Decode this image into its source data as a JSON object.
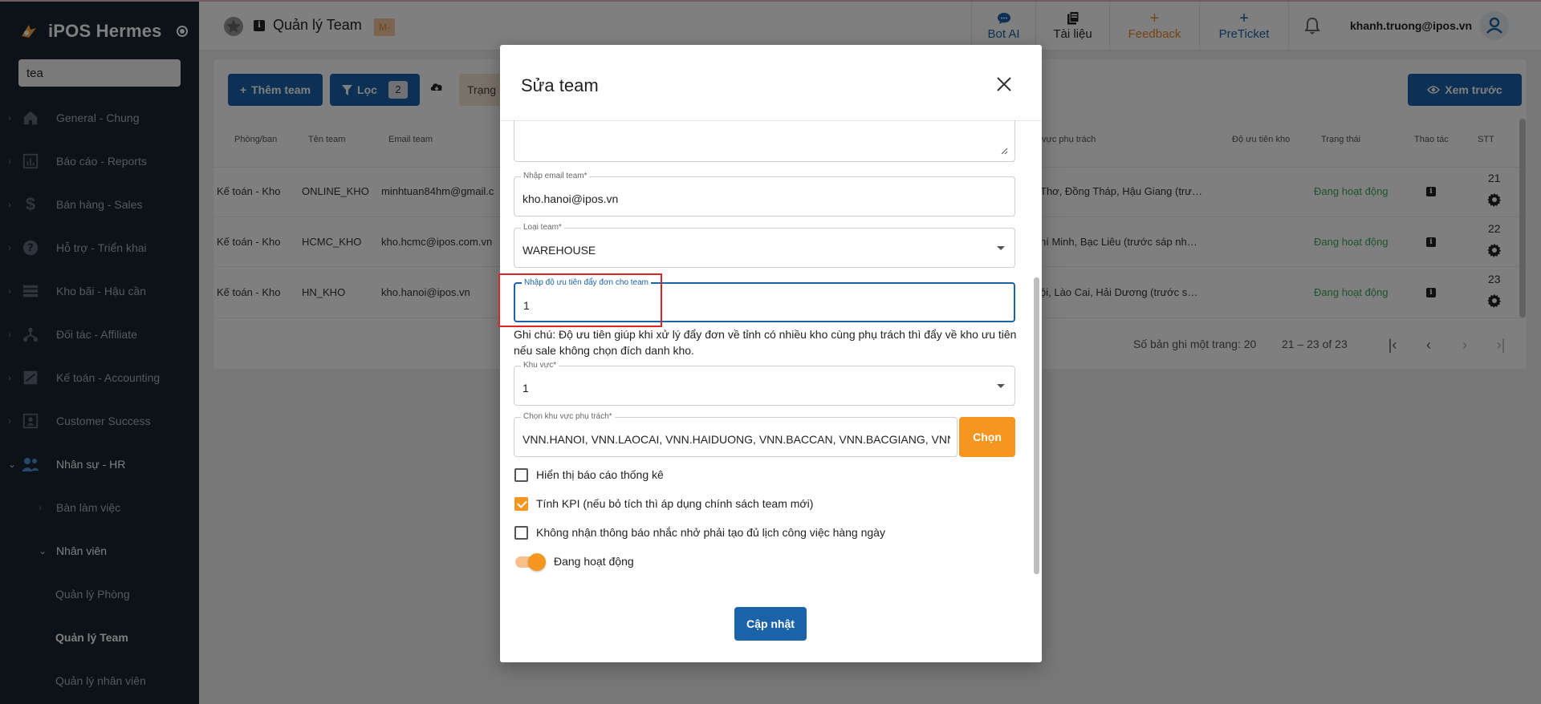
{
  "sidebar": {
    "brand": "iPOS Hermes",
    "search_value": "tea",
    "items": [
      {
        "label": "General - Chung",
        "icon": "home-icon"
      },
      {
        "label": "Báo cáo - Reports",
        "icon": "report-icon"
      },
      {
        "label": "Bán hàng - Sales",
        "icon": "dollar-icon"
      },
      {
        "label": "Hỗ trợ - Triển khai",
        "icon": "help-icon"
      },
      {
        "label": "Kho bãi - Hậu cần",
        "icon": "warehouse-icon"
      },
      {
        "label": "Đối tác - Affiliate",
        "icon": "affiliate-icon"
      },
      {
        "label": "Kế toán - Accounting",
        "icon": "accounting-icon"
      },
      {
        "label": "Customer Success",
        "icon": "customer-icon"
      },
      {
        "label": "Nhân sự - HR",
        "icon": "people-icon"
      }
    ],
    "hr_sub": {
      "workspace": "Bàn làm việc",
      "employee": "Nhân viên"
    },
    "employee_sub": [
      "Quản lý Phòng",
      "Quản lý Team",
      "Quản lý nhân viên"
    ]
  },
  "header": {
    "title": "Quản lý Team",
    "badge": "M-",
    "buttons": [
      {
        "label": "Bot AI",
        "icon": "chat-icon",
        "color": "#1b63a8"
      },
      {
        "label": "Tài liệu",
        "icon": "book-icon",
        "color": "#222222"
      },
      {
        "label": "Feedback",
        "icon": "+",
        "color": "#e8892c"
      },
      {
        "label": "PreTicket",
        "icon": "+",
        "color": "#1b63a8"
      }
    ],
    "user_email": "khanh.truong@ipos.vn"
  },
  "toolbar": {
    "add_label": "Thêm team",
    "filter_label": "Lọc",
    "filter_count": "2",
    "status_chip": "Trạng thái",
    "preview_label": "Xem trước"
  },
  "table": {
    "headers": {
      "dept": "Phòng/ban",
      "team": "Tên team",
      "email": "Email team",
      "area": "vực phụ trách",
      "priority": "Độ ưu tiên kho",
      "status": "Trạng thái",
      "action": "Thao tác",
      "stt": "STT"
    },
    "rows": [
      {
        "dept": "Kế toán - Kho",
        "team": "ONLINE_KHO",
        "email": "minhtuan84hm@gmail.c",
        "area": "Thơ, Đồng Tháp, Hậu Giang (trư…",
        "status": "Đang hoạt động",
        "stt": "21"
      },
      {
        "dept": "Kế toán - Kho",
        "team": "HCMC_KHO",
        "email": "kho.hcmc@ipos.com.vn",
        "area": "hí Minh, Bạc Liêu (trước sáp nh…",
        "status": "Đang hoạt động",
        "stt": "22"
      },
      {
        "dept": "Kế toán - Kho",
        "team": "HN_KHO",
        "email": "kho.hanoi@ipos.vn",
        "area": "ội, Lào Cai, Hải Dương (trước s…",
        "status": "Đang hoạt động",
        "stt": "23"
      }
    ],
    "rows_per_page_label": "Số bản ghi một trang: 20",
    "range": "21 – 23 of 23"
  },
  "modal": {
    "title": "Sửa team",
    "email_label": "Nhập email team*",
    "email_value": "kho.hanoi@ipos.vn",
    "type_label": "Loại team*",
    "type_value": "WAREHOUSE",
    "priority_label": "Nhập độ ưu tiên đẩy đơn cho team",
    "priority_value": "1",
    "hint": "Ghi chú: Độ ưu tiên giúp khi xử lý đẩy đơn về tỉnh có nhiều kho cùng phụ trách thì đẩy về kho ưu tiên nếu sale không chọn đích danh kho.",
    "region_label": "Khu vực*",
    "region_value": "1",
    "areas_label": "Chọn khu vực phụ trách*",
    "areas_value": "VNN.HANOI, VNN.LAOCAI, VNN.HAIDUONG, VNN.BACCAN, VNN.BACGIANG, VNN.CAOBANG",
    "choose_label": "Chọn",
    "cb_report": "Hiển thị báo cáo thống kê",
    "cb_kpi": "Tính KPI (nếu bỏ tích thì áp dụng chính sách team mới)",
    "cb_notify": "Không nhận thông báo nhắc nhở phải tạo đủ lịch công việc hàng ngày",
    "active_label": "Đang hoạt động",
    "update_label": "Cập nhật"
  }
}
